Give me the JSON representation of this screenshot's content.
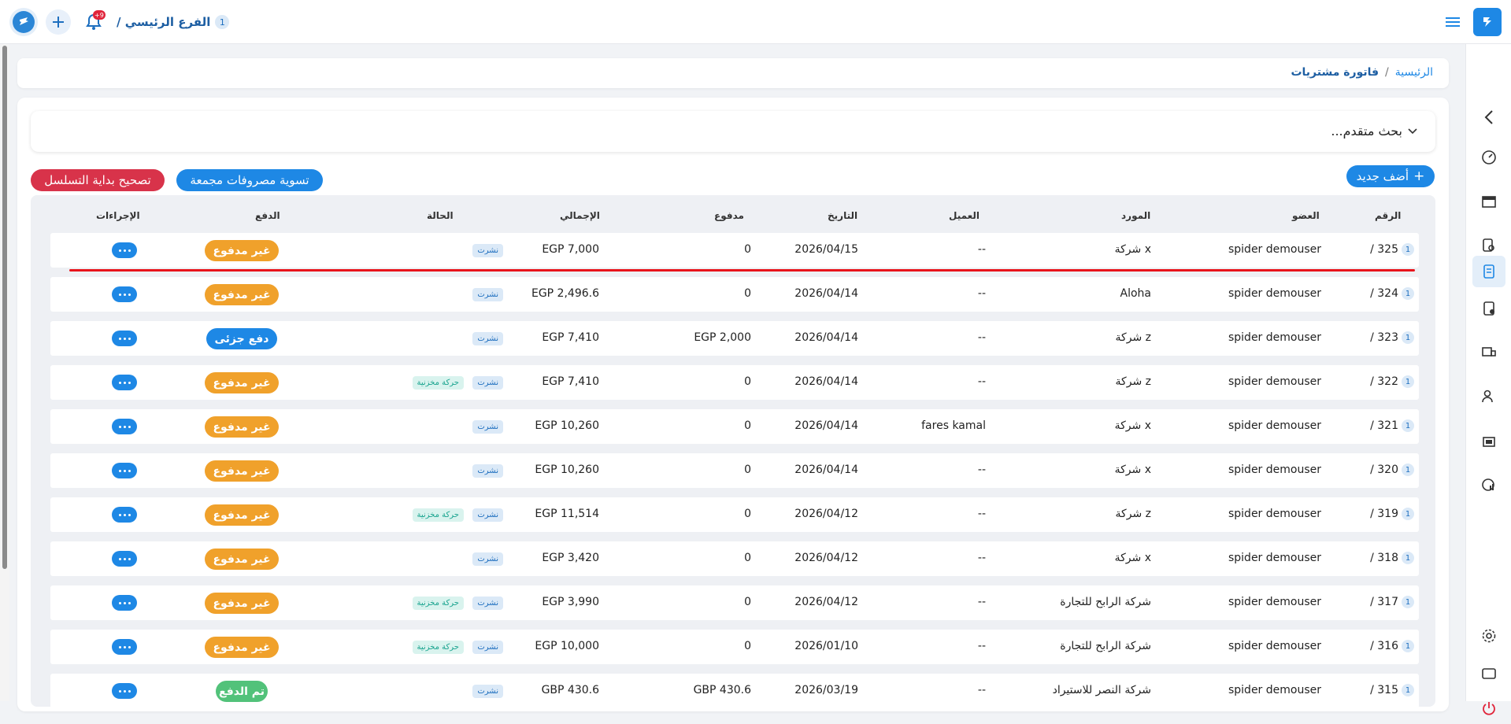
{
  "topbar": {
    "branch_label": "الفرع الرئيسي /",
    "branch_count": "1",
    "notif_count": "+9"
  },
  "breadcrumb": {
    "home": "الرئيسية",
    "sep": "/",
    "current": "فاتورة مشتريات"
  },
  "search": {
    "label": "بحث متقدم..."
  },
  "buttons": {
    "add_new": "أضف جديد",
    "settle": "تسوية مصروفات مجمعة",
    "fix_sequence": "تصحيح بداية التسلسل"
  },
  "colors": {
    "primary": "#1e88e5",
    "orange": "#f0a12b",
    "green": "#52c27a",
    "red": "#d8334a"
  },
  "table": {
    "headers": {
      "number": "الرقم",
      "member": "العضو",
      "supplier": "المورد",
      "client": "العميل",
      "date": "التاريخ",
      "paid": "مدفوع",
      "total": "الإجمالي",
      "status": "الحالة",
      "payment": "الدفع",
      "actions": "الإجراءات"
    },
    "rows": [
      {
        "badge": "1",
        "num": "325 /",
        "member": "spider demouser",
        "supplier": "شركة x",
        "client": "--",
        "date": "2026/04/15",
        "paid": "0",
        "total": "EGP 7,000",
        "status": "نشرت",
        "stock": "",
        "payment": "غير مدفوع",
        "pay_type": "unpaid"
      },
      {
        "badge": "1",
        "num": "324 /",
        "member": "spider demouser",
        "supplier": "Aloha",
        "client": "--",
        "date": "2026/04/14",
        "paid": "0",
        "total": "EGP 2,496.6",
        "status": "نشرت",
        "stock": "",
        "payment": "غير مدفوع",
        "pay_type": "unpaid"
      },
      {
        "badge": "1",
        "num": "323 /",
        "member": "spider demouser",
        "supplier": "شركة z",
        "client": "--",
        "date": "2026/04/14",
        "paid": "EGP 2,000",
        "total": "EGP 7,410",
        "status": "نشرت",
        "stock": "",
        "payment": "دفع جزئى",
        "pay_type": "partial"
      },
      {
        "badge": "1",
        "num": "322 /",
        "member": "spider demouser",
        "supplier": "شركة z",
        "client": "--",
        "date": "2026/04/14",
        "paid": "0",
        "total": "EGP 7,410",
        "status": "نشرت",
        "stock": "حركة مخزنية",
        "payment": "غير مدفوع",
        "pay_type": "unpaid"
      },
      {
        "badge": "1",
        "num": "321 /",
        "member": "spider demouser",
        "supplier": "شركة x",
        "client": "fares kamal",
        "date": "2026/04/14",
        "paid": "0",
        "total": "EGP 10,260",
        "status": "نشرت",
        "stock": "",
        "payment": "غير مدفوع",
        "pay_type": "unpaid"
      },
      {
        "badge": "1",
        "num": "320 /",
        "member": "spider demouser",
        "supplier": "شركة x",
        "client": "--",
        "date": "2026/04/14",
        "paid": "0",
        "total": "EGP 10,260",
        "status": "نشرت",
        "stock": "",
        "payment": "غير مدفوع",
        "pay_type": "unpaid"
      },
      {
        "badge": "1",
        "num": "319 /",
        "member": "spider demouser",
        "supplier": "شركة z",
        "client": "--",
        "date": "2026/04/12",
        "paid": "0",
        "total": "EGP 11,514",
        "status": "نشرت",
        "stock": "حركة مخزنية",
        "payment": "غير مدفوع",
        "pay_type": "unpaid"
      },
      {
        "badge": "1",
        "num": "318 /",
        "member": "spider demouser",
        "supplier": "شركة x",
        "client": "--",
        "date": "2026/04/12",
        "paid": "0",
        "total": "EGP 3,420",
        "status": "نشرت",
        "stock": "",
        "payment": "غير مدفوع",
        "pay_type": "unpaid"
      },
      {
        "badge": "1",
        "num": "317 /",
        "member": "spider demouser",
        "supplier": "شركة الرابح للتجارة",
        "client": "--",
        "date": "2026/04/12",
        "paid": "0",
        "total": "EGP 3,990",
        "status": "نشرت",
        "stock": "حركة مخزنية",
        "payment": "غير مدفوع",
        "pay_type": "unpaid"
      },
      {
        "badge": "1",
        "num": "316 /",
        "member": "spider demouser",
        "supplier": "شركة الرابح للتجارة",
        "client": "--",
        "date": "2026/01/10",
        "paid": "0",
        "total": "EGP 10,000",
        "status": "نشرت",
        "stock": "حركة مخزنية",
        "payment": "غير مدفوع",
        "pay_type": "unpaid"
      },
      {
        "badge": "1",
        "num": "315 /",
        "member": "spider demouser",
        "supplier": "شركة النصر للاستيراد",
        "client": "--",
        "date": "2026/03/19",
        "paid": "GBP 430.6",
        "total": "GBP 430.6",
        "status": "نشرت",
        "stock": "",
        "payment": "تم الدفع",
        "pay_type": "paid"
      }
    ]
  },
  "sidebar_icons": [
    "chevron-left-icon",
    "dashboard-icon",
    "store-icon",
    "search-document-icon",
    "invoice-icon",
    "document-return-icon",
    "box-truck-icon",
    "users-icon",
    "gift-box-icon",
    "reports-icon",
    "settings-icon",
    "screen-icon",
    "power-icon"
  ]
}
